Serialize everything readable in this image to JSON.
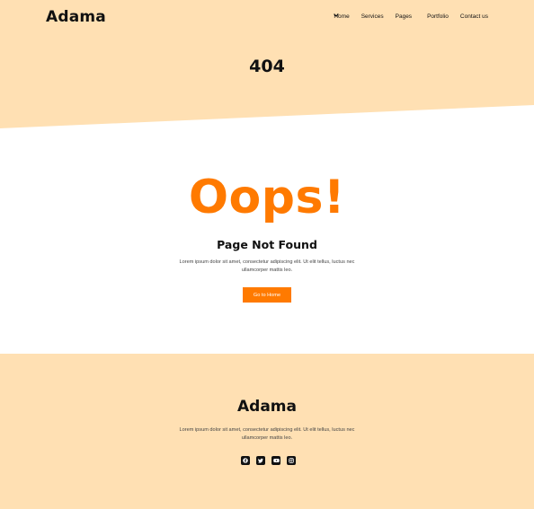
{
  "colors": {
    "hero_bg": "#ffe0b3",
    "accent": "#ff7a00",
    "footer_bg": "#ffe0b3",
    "text": "#111111"
  },
  "header": {
    "logo": "Adama",
    "menu": [
      {
        "label": "Home"
      },
      {
        "label": "Services"
      },
      {
        "label": "Pages",
        "has_dropdown": true
      },
      {
        "label": "Portfolio"
      },
      {
        "label": "Contact us"
      }
    ],
    "title": "404"
  },
  "main": {
    "headline": "Oops!",
    "subtitle": "Page Not Found",
    "text": "Lorem ipsum dolor sit amet, consectetur adipiscing elit. Ut elit tellus, luctus nec ullamcorper mattis leo.",
    "button_label": "Go to Home"
  },
  "footer": {
    "logo": "Adama",
    "text": "Lorem ipsum dolor sit amet, consectetur adipiscing elit. Ut elit tellus, luctus nec ullamcorper mattis leo.",
    "socials": [
      {
        "icon": "facebook-icon"
      },
      {
        "icon": "twitter-icon"
      },
      {
        "icon": "youtube-icon"
      },
      {
        "icon": "instagram-icon"
      }
    ]
  }
}
